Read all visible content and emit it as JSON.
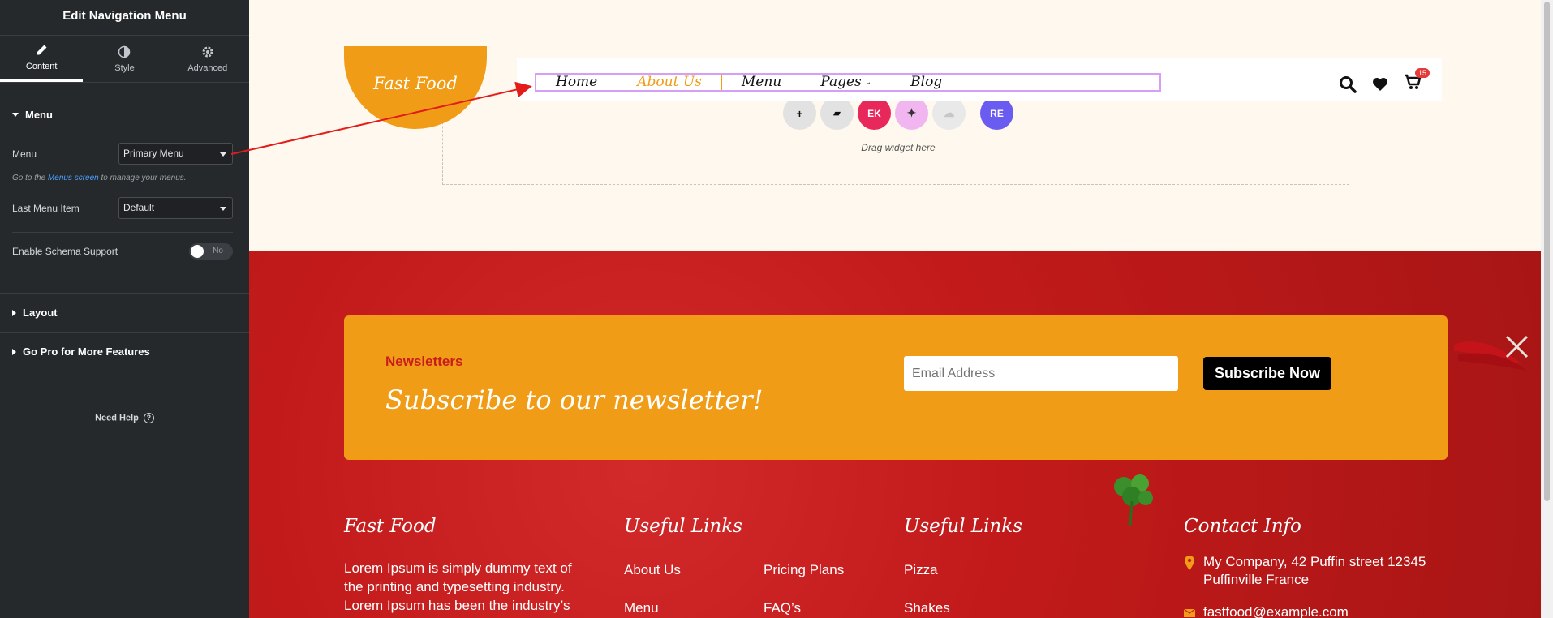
{
  "panel": {
    "title": "Edit Navigation Menu",
    "tabs": [
      {
        "label": "Content",
        "icon": "pencil-icon"
      },
      {
        "label": "Style",
        "icon": "contrast-icon"
      },
      {
        "label": "Advanced",
        "icon": "gear-icon"
      }
    ],
    "sections": {
      "menu": "Menu",
      "layout": "Layout",
      "pro": "Go Pro for More Features"
    },
    "menu_label": "Menu",
    "menu_value": "Primary Menu",
    "hint_prefix": "Go to the ",
    "hint_link": "Menus screen",
    "hint_suffix": " to manage your menus.",
    "last_item_label": "Last Menu Item",
    "last_item_value": "Default",
    "schema_label": "Enable Schema Support",
    "schema_toggle": "No",
    "need_help": "Need Help",
    "help_icon": "?"
  },
  "header": {
    "logo": "Fast Food",
    "nav": [
      "Home",
      "About Us",
      "Menu",
      "Pages",
      "Blog"
    ],
    "cart_count": "15",
    "drag_text": "Drag widget here"
  },
  "widget_icons": [
    {
      "name": "add-icon",
      "glyph": "+"
    },
    {
      "name": "folder-icon",
      "glyph": "▰"
    },
    {
      "name": "elementskit-icon",
      "glyph": "EK"
    },
    {
      "name": "ai-sparkle-icon",
      "glyph": "✦"
    },
    {
      "name": "template-kit-icon",
      "glyph": "☁"
    },
    {
      "name": "royal-elements-icon",
      "glyph": "RE"
    }
  ],
  "newsletter": {
    "label": "Newsletters",
    "title": "Subscribe to our newsletter!",
    "placeholder": "Email Address",
    "button": "Subscribe Now"
  },
  "footer": {
    "brand_title": "Fast Food",
    "brand_text": "Lorem Ipsum is simply dummy text of the printing and typesetting industry. Lorem Ipsum has been the industry’s",
    "links1_title": "Useful Links",
    "links1": [
      "About Us",
      "Menu",
      "Pricing Plans",
      "FAQ’s"
    ],
    "links2_title": "Useful Links",
    "links2": [
      "Pizza",
      "Shakes"
    ],
    "contact_title": "Contact Info",
    "address": "My Company, 42 Puffin street 12345 Puffinville France",
    "email": "fastfood@example.com"
  },
  "colors": {
    "accent": "#f09c17",
    "footer_red": "#c91d1d",
    "panel_bg": "#26292c"
  }
}
